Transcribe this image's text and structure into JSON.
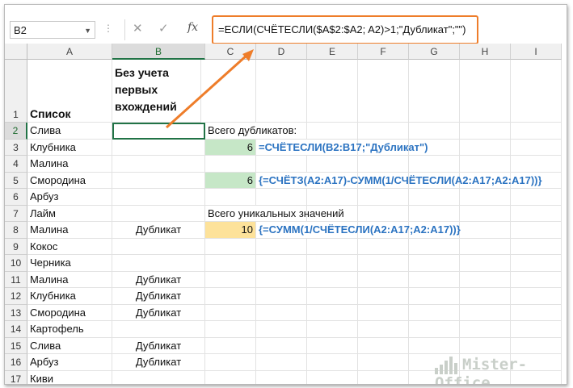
{
  "formula_bar": {
    "name_box": "B2",
    "formula": "=ЕСЛИ(СЧЁТЕСЛИ($A$2:$A2; A2)>1;\"Дубликат\";\"\")"
  },
  "columns": [
    "A",
    "B",
    "C",
    "D",
    "E",
    "F",
    "G",
    "H",
    "I"
  ],
  "rows": [
    "1",
    "2",
    "3",
    "4",
    "5",
    "6",
    "7",
    "8",
    "9",
    "10",
    "11",
    "12",
    "13",
    "14",
    "15",
    "16",
    "17"
  ],
  "cells": {
    "A1": "Список",
    "B1": "Без учета первых вхождений",
    "A2": "Слива",
    "A3": "Клубника",
    "A4": "Малина",
    "A5": "Смородина",
    "A6": "Арбуз",
    "A7": "Лайм",
    "A8": "Малина",
    "A9": "Кокос",
    "A10": "Черника",
    "A11": "Малина",
    "A12": "Клубника",
    "A13": "Смородина",
    "A14": "Картофель",
    "A15": "Слива",
    "A16": "Арбуз",
    "A17": "Киви",
    "B8": "Дубликат",
    "B11": "Дубликат",
    "B12": "Дубликат",
    "B13": "Дубликат",
    "B15": "Дубликат",
    "B16": "Дубликат",
    "C2": "Всего дубликатов:",
    "C3": "6",
    "D3": "=СЧЁТЕСЛИ(B2:B17;\"Дубликат\")",
    "C5": "6",
    "D5": "{=СЧЁТЗ(A2:A17)-СУММ(1/СЧЁТЕСЛИ(A2:A17;A2:A17))}",
    "C7": "Всего уникальных значений",
    "C8": "10",
    "D8": "{=СУММ(1/СЧЁТЕСЛИ(A2:A17;A2:A17))}"
  },
  "watermark": "Mister-Office",
  "colors": {
    "highlight_orange": "#ee7d2a",
    "green_fill": "#c6e7c7",
    "yellow_fill": "#fde29a",
    "formula_blue": "#2b73c1",
    "excel_green": "#217346"
  },
  "icons": [
    "cancel-icon",
    "enter-icon",
    "function-icon",
    "dropdown-icon"
  ]
}
